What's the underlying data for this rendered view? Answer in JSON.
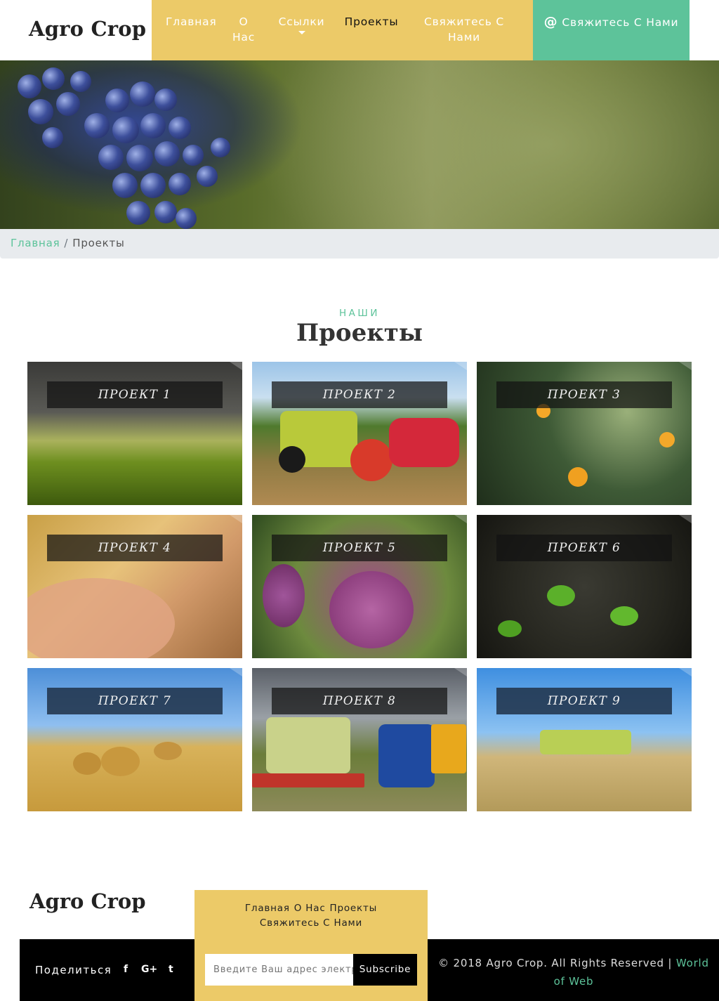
{
  "header": {
    "brand": "Agro Crop",
    "nav": [
      {
        "label": "Главная"
      },
      {
        "label": "О Нас"
      },
      {
        "label": "Ссылки"
      },
      {
        "label": "Проекты"
      },
      {
        "label": "Свяжитесь С Нами"
      }
    ],
    "contact_button": "Свяжитесь С Нами",
    "contact_icon": "@"
  },
  "breadcrumb": {
    "home": "Главная",
    "separator": "/",
    "current": "Проекты"
  },
  "section": {
    "kicker": "НАШИ",
    "title": "Проекты"
  },
  "projects": [
    {
      "label": "ПРОЕКТ 1"
    },
    {
      "label": "ПРОЕКТ 2"
    },
    {
      "label": "ПРОЕКТ 3"
    },
    {
      "label": "ПРОЕКТ 4"
    },
    {
      "label": "ПРОЕКТ 5"
    },
    {
      "label": "ПРОЕКТ 6"
    },
    {
      "label": "ПРОЕКТ 7"
    },
    {
      "label": "ПРОЕКТ 8"
    },
    {
      "label": "ПРОЕКТ 9"
    }
  ],
  "footer": {
    "brand": "Agro Crop",
    "links": [
      "Главная",
      "О Нас",
      "Проекты",
      "Свяжитесь С Нами"
    ],
    "share_label": "Поделиться",
    "social_icons": [
      "facebook-icon",
      "google-plus-icon",
      "twitter-icon"
    ],
    "social_glyphs": {
      "facebook": "f",
      "google": "G+",
      "twitter": "t"
    },
    "email_placeholder": "Введите Ваш адрес электронной почты",
    "subscribe_label": "Subscribe",
    "copyright": "© 2018 Agro Crop. All Rights Reserved |",
    "credit": "World of Web"
  },
  "colors": {
    "accent_yellow": "#ecca68",
    "accent_green": "#5dc39a"
  }
}
